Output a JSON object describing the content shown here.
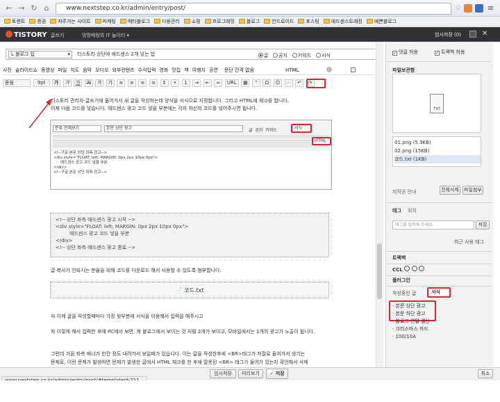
{
  "browser": {
    "url": "www.nextstep.co.kr/admin/entry/post/",
    "bookmarks": [
      "토렌트",
      "증권",
      "자주가는 사이트",
      "마케팅",
      "메타블로그",
      "다용관리",
      "쇼핑",
      "프로그래밍",
      "블로그",
      "안드로이드",
      "포스팅",
      "애드센스트래킹",
      "예쁜블로그"
    ],
    "status_url": "www.nextstep.co.kr/admin/entry/post/#templateId-211"
  },
  "app": {
    "logo": "TISTORY",
    "write_label": "글쓰기",
    "blog_name": "멍멍매왕의 IT 놀이터",
    "temp_save": "임시저장 (0)",
    "colors": {
      "brand": "#e8502b",
      "topbar": "#2f3338",
      "annotation": "#d22233"
    }
  },
  "editor": {
    "category": "L 블로그 팁",
    "title": "티스토리 상단에 애드센스 2개 넣는 법",
    "post_types": [
      "글",
      "공지",
      "키워드",
      "서식"
    ],
    "toolbar1": [
      "사진",
      "슬라이드쇼",
      "동영상",
      "파일",
      "지도",
      "음악",
      "오디오",
      "외부컨텐츠",
      "수식입력",
      "영화",
      "맛집",
      "책",
      "여행지",
      "공연",
      "문단 간격 없음",
      "HTML"
    ],
    "font": "돋움",
    "font_size": "9pt",
    "url_label": "URL"
  },
  "content": {
    "para1": "티스토리 관리자-글쓰기에 들어가서 새 글을 작성하는데 양식을 서식으로 지정합니다. 그리고 HTML에 체크를 합니다.",
    "para2": "이제 다음 코드를 넣습니다. 헤드센스 광고 코드 넣을 부분에는 각자 자신의 코드를 넣어주시면 됩니다.",
    "shot": {
      "category": "분류 전체보기",
      "title": "본문 상단 광고",
      "types": [
        "글",
        "공지",
        "키워드",
        "서식"
      ],
      "html_label": "HTML",
      "code_lines": [
        "<!--구글 본문 상단 좌측 광고-->",
        "<div style=\"FLOAT: left; MARGIN: 0px 2px 10px 0px\">",
        "애드센스 광고 코드 넣을 부분",
        "</div>",
        "<!--구글 본문 상단 좌측 광고-->"
      ]
    },
    "code_lines": [
      "<!-- 상단 좌측 애드센스 광고 시작 -->",
      "<div style=\"FLOAT: left; MARGIN: 0px 2px 10px 0px\">",
      "애드센스 광고 코드 넣을 부분",
      "</div>",
      "<!-- 상단 좌측 애드센스 광고 종료 -->"
    ],
    "para3": "글 복사가 안되시는 분들을 위해 코드를 다운로드 해서 사용할 수 있도록 첨부합니다.",
    "file_name": "코드.txt",
    "para4": "자 이제 글을 작성할때마다 가장 윗부분에 서식을 이용해서 입력을 해주시고",
    "para5": "자 이렇게 해서 입력한 후에 PC에서 보면, 제 블로그에서 보이는 것 처럼 2개가 보이고, 모바일에서는 1개의 광고가 노출이 됩니다.",
    "para6": "그런데 가끔 좌측 배너가 한칸 정도 내려가서 보일때가 있습니다. 이는 글을 작성한후에 <BR>태그가 저절로 들어가서 생기는",
    "para7": "문제로, 이런 문제가 발생하면 문제가 발생한 글에서 HTML 체크를 한 후에 잘못된 <BR> 태그가 들어가 있는지 확인해서 삭제"
  },
  "sidebar": {
    "comment_allow": "댓글 허용",
    "trackback_allow": "트랙백 허용",
    "file_manage_title": "파일보관함",
    "file_icon_label": "TXT",
    "files": [
      "01.png (5.3KB)",
      "02.png (15KB)",
      "코드.txt (1KB)"
    ],
    "image_guide": "저작권 안내",
    "delete_all": "전체삭제",
    "attach_file": "파일첨부",
    "tag_title": "태그",
    "location_title": "위치",
    "tag_placeholder": "태그를 입력해 주세요.",
    "tag_register": "저장",
    "recent_tags": "최근 사용 태그",
    "trackback_title": "트랙백",
    "ccl_title": "CCL",
    "plugin_title": "플러그인",
    "tab_writing": "작성중인 글",
    "tab_template": "서식",
    "templates": [
      "본문 상단 광고",
      "본문 하단 광고",
      "블로그 연말 결산",
      "크리스마스 카드",
      "100/10A"
    ]
  },
  "footer": {
    "temp_save": "임시저장",
    "preview": "미리보기",
    "save": "저장",
    "cancel": "취소"
  }
}
